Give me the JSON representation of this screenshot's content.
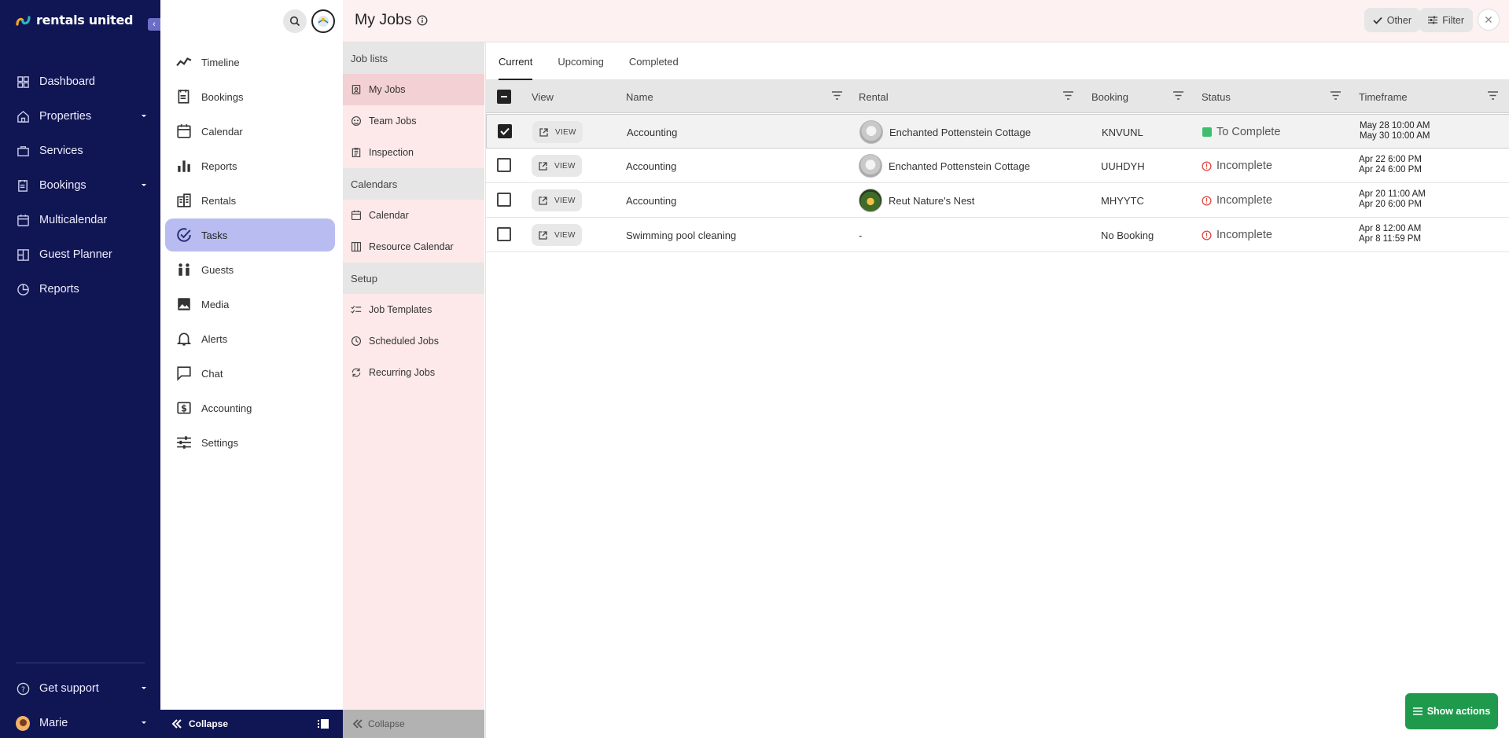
{
  "brand": {
    "name": "rentals united"
  },
  "primary_nav": {
    "items": [
      {
        "label": "Dashboard",
        "icon": "dashboard-icon"
      },
      {
        "label": "Properties",
        "icon": "home-icon",
        "has_submenu": true
      },
      {
        "label": "Services",
        "icon": "briefcase-icon"
      },
      {
        "label": "Bookings",
        "icon": "bookings-icon",
        "has_submenu": true
      },
      {
        "label": "Multicalendar",
        "icon": "calendar-icon"
      },
      {
        "label": "Guest Planner",
        "icon": "planner-icon"
      },
      {
        "label": "Reports",
        "icon": "reports-icon"
      }
    ],
    "support_label": "Get support",
    "user_name": "Marie"
  },
  "secondary_nav": {
    "items": [
      {
        "label": "Timeline",
        "icon": "timeline-icon"
      },
      {
        "label": "Bookings",
        "icon": "bookings-icon"
      },
      {
        "label": "Calendar",
        "icon": "calendar-icon"
      },
      {
        "label": "Reports",
        "icon": "bar-chart-icon"
      },
      {
        "label": "Rentals",
        "icon": "building-icon"
      },
      {
        "label": "Tasks",
        "icon": "check-circle-icon",
        "active": true
      },
      {
        "label": "Guests",
        "icon": "people-icon"
      },
      {
        "label": "Media",
        "icon": "image-icon"
      },
      {
        "label": "Alerts",
        "icon": "bell-icon"
      },
      {
        "label": "Chat",
        "icon": "chat-icon"
      },
      {
        "label": "Accounting",
        "icon": "dollar-icon"
      },
      {
        "label": "Settings",
        "icon": "sliders-icon"
      }
    ],
    "collapse_label": "Collapse"
  },
  "tertiary_nav": {
    "sections": [
      {
        "title": "Job lists",
        "items": [
          {
            "label": "My Jobs",
            "icon": "badge-icon",
            "active": true
          },
          {
            "label": "Team Jobs",
            "icon": "team-icon"
          },
          {
            "label": "Inspection",
            "icon": "clipboard-icon"
          }
        ]
      },
      {
        "title": "Calendars",
        "items": [
          {
            "label": "Calendar",
            "icon": "calendar-icon"
          },
          {
            "label": "Resource Calendar",
            "icon": "columns-icon"
          }
        ]
      },
      {
        "title": "Setup",
        "items": [
          {
            "label": "Job Templates",
            "icon": "checklist-icon"
          },
          {
            "label": "Scheduled Jobs",
            "icon": "clock-icon"
          },
          {
            "label": "Recurring Jobs",
            "icon": "repeat-icon"
          }
        ]
      }
    ],
    "collapse_label": "Collapse"
  },
  "header": {
    "title": "My Jobs",
    "other_label": "Other",
    "filter_label": "Filter"
  },
  "tabs": [
    {
      "label": "Current",
      "active": true
    },
    {
      "label": "Upcoming"
    },
    {
      "label": "Completed"
    }
  ],
  "table": {
    "columns": {
      "view": "View",
      "name": "Name",
      "rental": "Rental",
      "booking": "Booking",
      "status": "Status",
      "timeframe": "Timeframe"
    },
    "view_label": "VIEW",
    "rows": [
      {
        "checked": true,
        "name": "Accounting",
        "rental": "Enchanted Pottenstein Cottage",
        "rental_thumb": "grey",
        "booking": "KNVUNL",
        "status": "To Complete",
        "status_kind": "ok",
        "time_start": "May 28 10:00 AM",
        "time_end": "May 30 10:00 AM"
      },
      {
        "checked": false,
        "name": "Accounting",
        "rental": "Enchanted Pottenstein Cottage",
        "rental_thumb": "grey",
        "booking": "UUHDYH",
        "status": "Incomplete",
        "status_kind": "warn",
        "time_start": "Apr 22 6:00 PM",
        "time_end": "Apr 24 6:00 PM"
      },
      {
        "checked": false,
        "name": "Accounting",
        "rental": "Reut Nature's Nest",
        "rental_thumb": "green",
        "booking": "MHYYTC",
        "status": "Incomplete",
        "status_kind": "warn",
        "time_start": "Apr 20 11:00 AM",
        "time_end": "Apr 20 6:00 PM"
      },
      {
        "checked": false,
        "name": "Swimming pool cleaning",
        "rental": "-",
        "rental_thumb": "none",
        "booking": "No Booking",
        "status": "Incomplete",
        "status_kind": "warn",
        "time_start": "Apr 8 12:00 AM",
        "time_end": "Apr 8 11:59 PM"
      }
    ]
  },
  "show_actions_label": "Show actions",
  "colors": {
    "nav_dark": "#101553",
    "active_item": "#b8bcf0",
    "tertiary_bg": "#fde9ea",
    "success": "#1f9a4d",
    "warning": "#e0443c"
  }
}
